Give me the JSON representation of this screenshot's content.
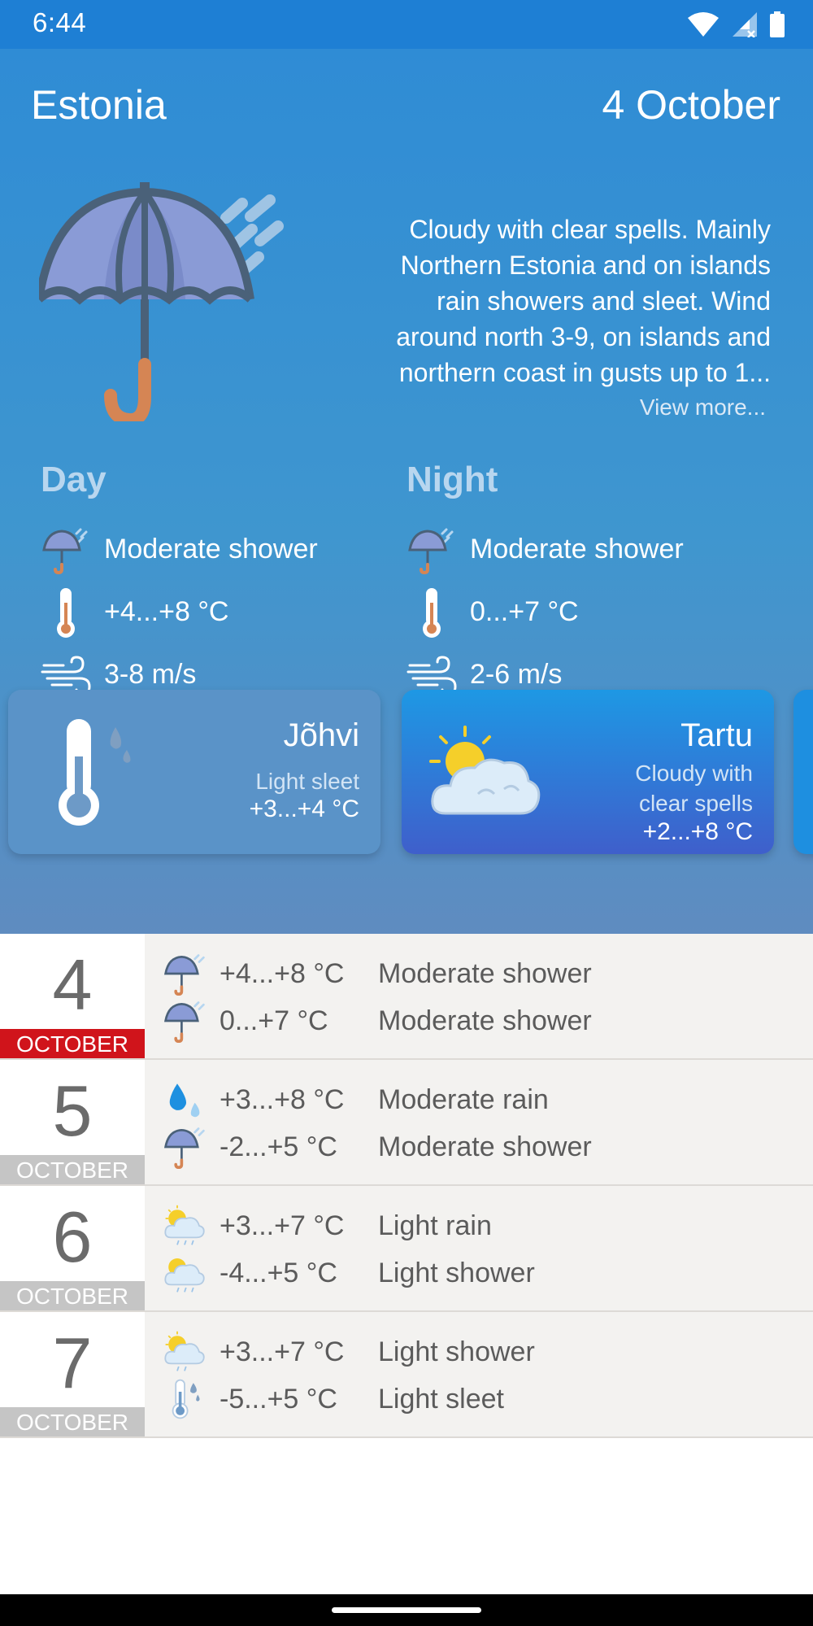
{
  "status": {
    "time": "6:44"
  },
  "header": {
    "country": "Estonia",
    "date": "4 October"
  },
  "summary": {
    "text_lines": [
      "Cloudy with clear spells. Mainly",
      "Northern Estonia and on islands",
      "rain showers and sleet. Wind",
      "around north 3-9, on islands and",
      "northern coast in gusts up to 1..."
    ],
    "view_more": "View more..."
  },
  "day": {
    "title": "Day",
    "condition": "Moderate shower",
    "temperature": "+4...+8 °C",
    "wind": "3-8 m/s"
  },
  "night": {
    "title": "Night",
    "condition": "Moderate shower",
    "temperature": "0...+7 °C",
    "wind": "2-6 m/s"
  },
  "cities": [
    {
      "name": "Jõhvi",
      "desc_lines": [
        "Light sleet"
      ],
      "temp": "+3...+4 °C",
      "icon": "thermometer-sleet-icon"
    },
    {
      "name": "Tartu",
      "desc_lines": [
        "Cloudy with",
        "clear spells"
      ],
      "temp": "+2...+8 °C",
      "icon": "sun-cloud-icon"
    }
  ],
  "forecast": [
    {
      "day": "4",
      "month": "OCTOBER",
      "active": true,
      "day_part": {
        "temp": "+4...+8 °C",
        "desc": "Moderate shower",
        "icon": "umbrella-icon"
      },
      "night_part": {
        "temp": "0...+7 °C",
        "desc": "Moderate shower",
        "icon": "umbrella-icon"
      }
    },
    {
      "day": "5",
      "month": "OCTOBER",
      "active": false,
      "day_part": {
        "temp": "+3...+8 °C",
        "desc": "Moderate rain",
        "icon": "raindrop-icon"
      },
      "night_part": {
        "temp": "-2...+5 °C",
        "desc": "Moderate shower",
        "icon": "umbrella-icon"
      }
    },
    {
      "day": "6",
      "month": "OCTOBER",
      "active": false,
      "day_part": {
        "temp": "+3...+7 °C",
        "desc": "Light rain",
        "icon": "sun-cloud-rain-icon"
      },
      "night_part": {
        "temp": "-4...+5 °C",
        "desc": "Light shower",
        "icon": "sun-cloud-rain-icon"
      }
    },
    {
      "day": "7",
      "month": "OCTOBER",
      "active": false,
      "day_part": {
        "temp": "+3...+7 °C",
        "desc": "Light shower",
        "icon": "sun-cloud-rain-icon"
      },
      "night_part": {
        "temp": "-5...+5 °C",
        "desc": "Light sleet",
        "icon": "thermometer-sleet-icon"
      }
    }
  ],
  "colors": {
    "accent": "#d0141b",
    "header_blue": "#1e7fd4",
    "row_bg": "#f3f2f0"
  }
}
